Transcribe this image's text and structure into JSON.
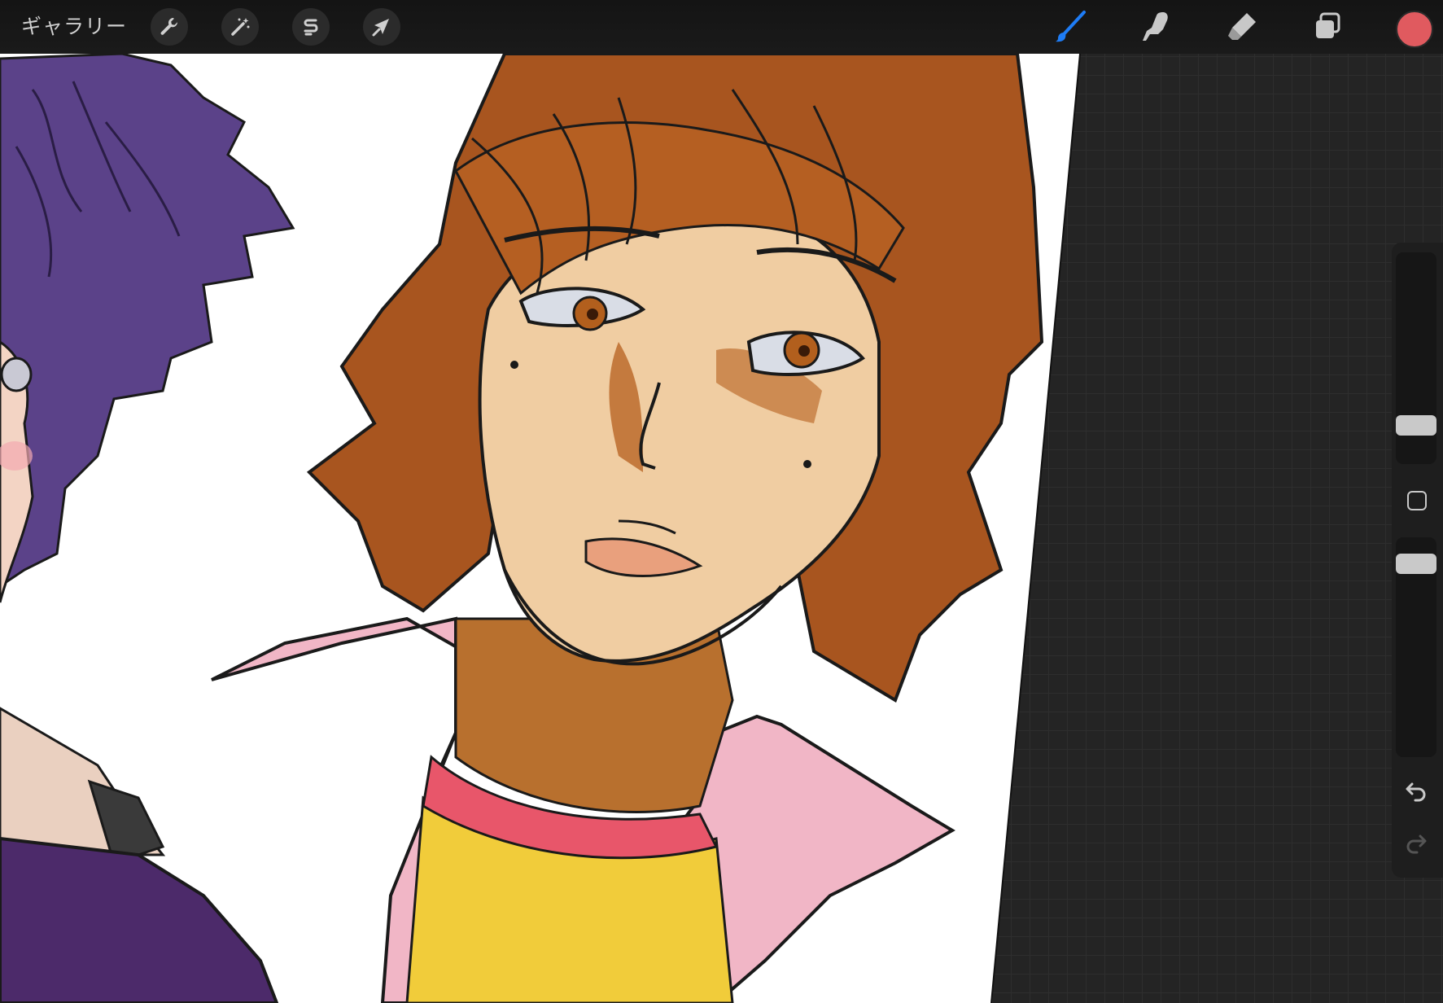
{
  "topbar": {
    "gallery_label": "ギャラリー",
    "left_tools": [
      {
        "name": "actions",
        "icon": "wrench-icon"
      },
      {
        "name": "adjustments",
        "icon": "magic-wand-icon"
      },
      {
        "name": "selection",
        "icon": "selection-s-icon"
      },
      {
        "name": "transform",
        "icon": "arrow-cursor-icon"
      }
    ],
    "right_tools": [
      {
        "name": "brush",
        "icon": "brush-icon",
        "active": true
      },
      {
        "name": "smudge",
        "icon": "smudge-finger-icon"
      },
      {
        "name": "eraser",
        "icon": "eraser-icon"
      },
      {
        "name": "layers",
        "icon": "layers-icon"
      }
    ],
    "current_color": "#e05a5f"
  },
  "sidebar": {
    "brush_size_slider": "size",
    "opacity_slider": "opacity",
    "modify_button": "square-icon",
    "undo": "undo-icon",
    "redo": "redo-icon"
  },
  "colors": {
    "accent": "#1e7cf5",
    "canvas_bg": "#242424",
    "paper": "#ffffff"
  }
}
